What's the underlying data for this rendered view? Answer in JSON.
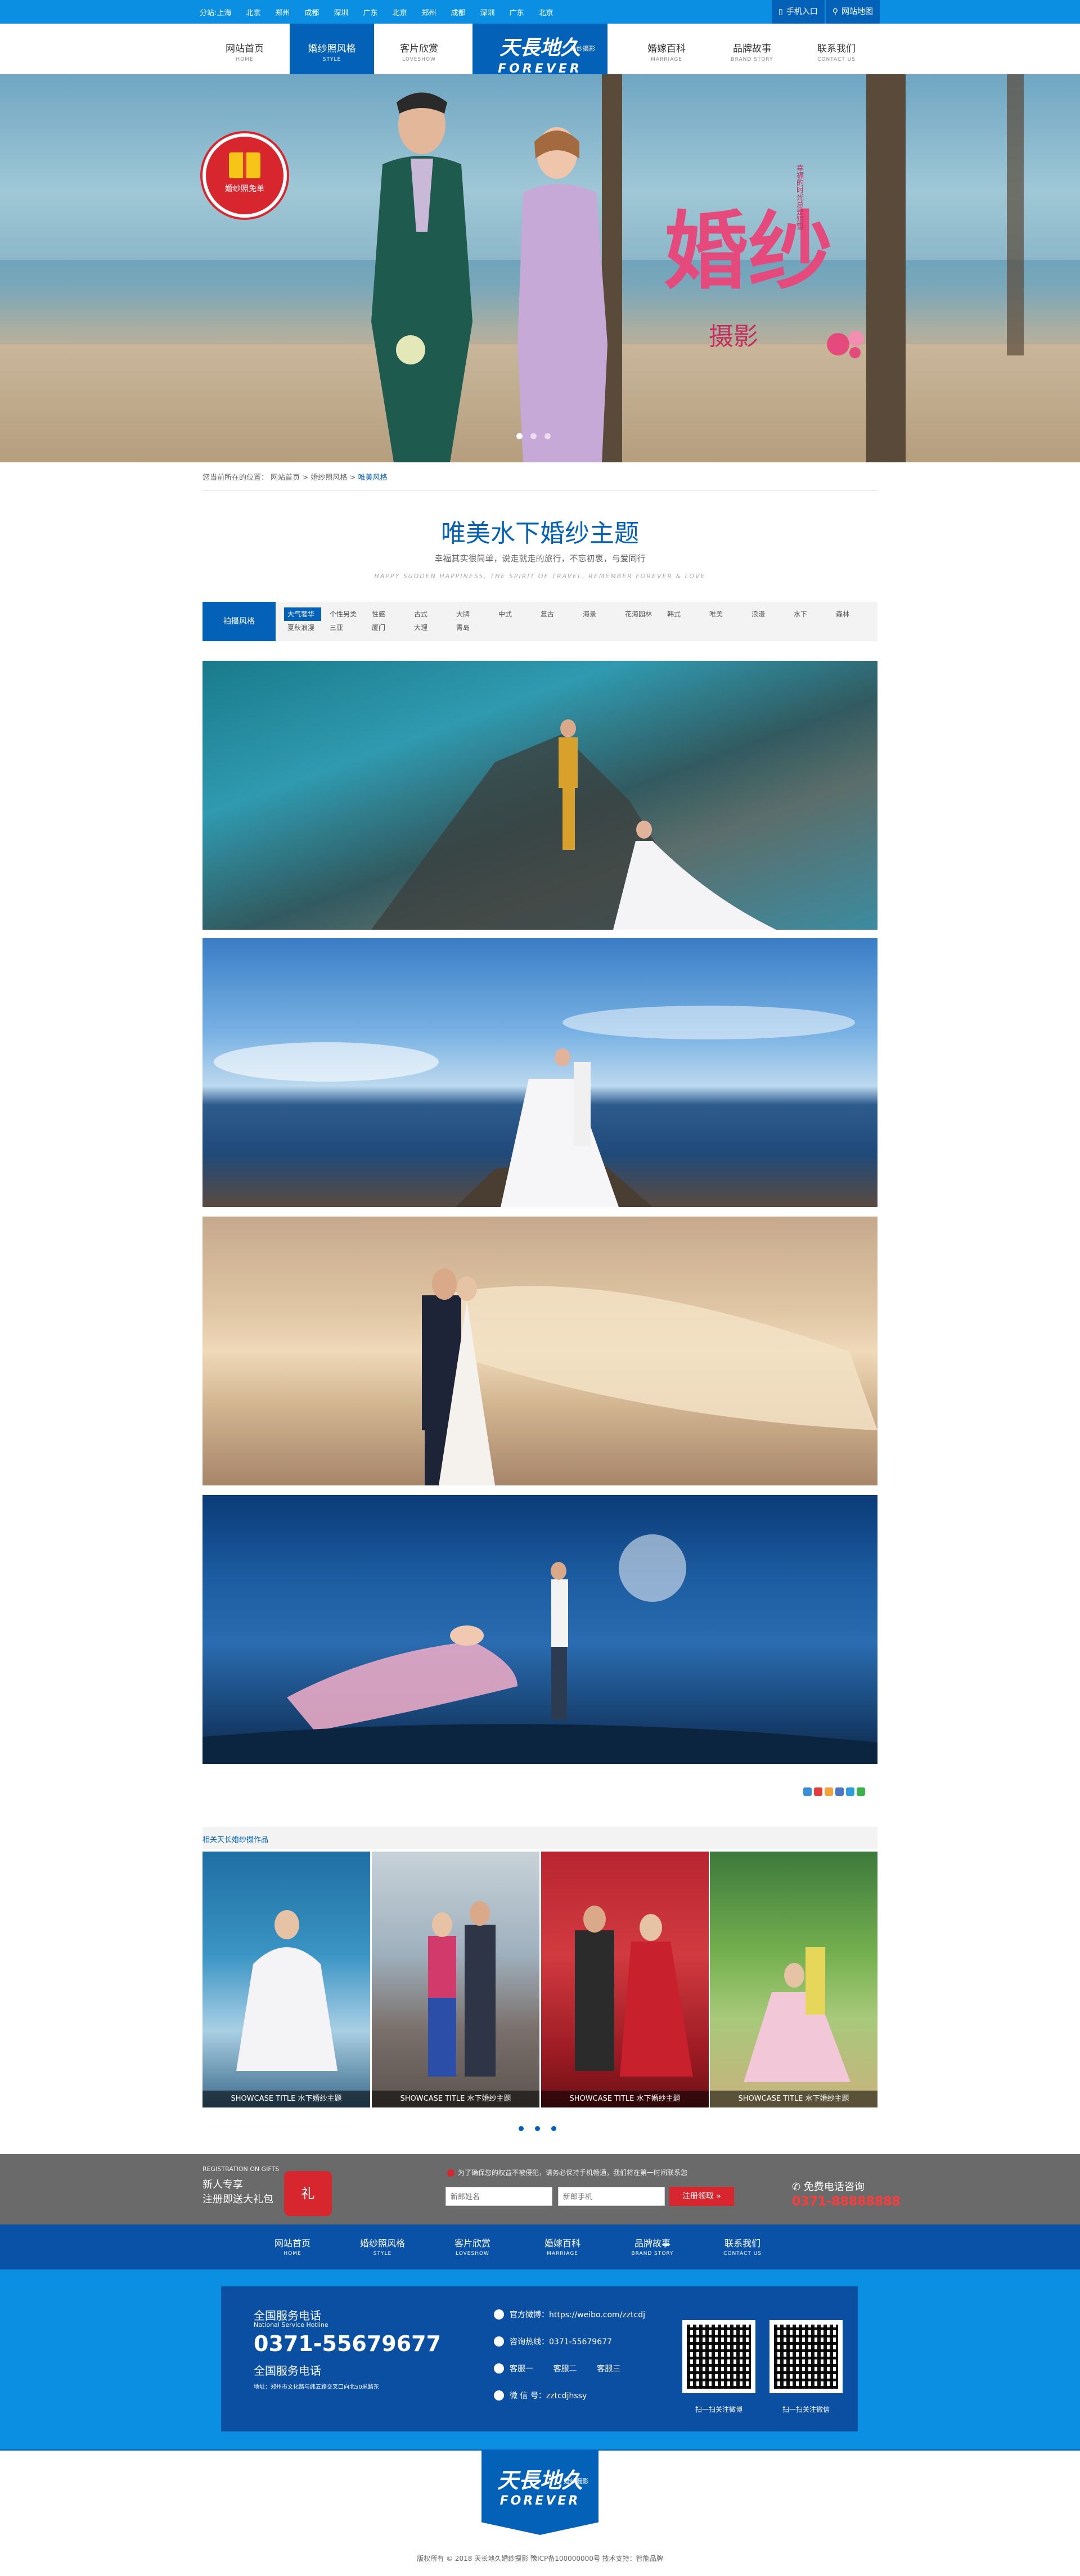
{
  "topbar": {
    "cities": [
      "分站:上海",
      "北京",
      "郑州",
      "成都",
      "深圳",
      "广东",
      "北京",
      "郑州",
      "成都",
      "深圳",
      "广东",
      "北京"
    ],
    "mobile": "手机入口",
    "map": "网站地图"
  },
  "nav": {
    "items": [
      {
        "zh": "网站首页",
        "en": "HOME"
      },
      {
        "zh": "婚纱照风格",
        "en": "STYLE"
      },
      {
        "zh": "客片欣赏",
        "en": "LOVESHOW"
      },
      {
        "zh": "婚嫁百科",
        "en": "MARRIAGE"
      },
      {
        "zh": "品牌故事",
        "en": "BRAND STORY"
      },
      {
        "zh": "联系我们",
        "en": "CONTACT US"
      }
    ],
    "logo_cn": "天長地久",
    "logo_sub": "婚纱摄影",
    "logo_en": "FOREVER"
  },
  "hero": {
    "badge": "婚纱照免单",
    "title_big": "婚纱",
    "title_small": "摄影",
    "side_text": "幸福的时光总是短暂"
  },
  "breadcrumb": {
    "prefix": "您当前所在的位置：",
    "home": "网站首页",
    "sep": ">",
    "level1": "婚纱照风格",
    "current": "唯美风格"
  },
  "page": {
    "title": "唯美水下婚纱主题",
    "subtitle": "幸福其实很简单，说走就走的旅行，不忘初衷，与爱同行",
    "english": "HAPPY SUDDEN HAPPINESS, THE SPIRIT OF TRAVEL, REMEMBER FOREVER & LOVE"
  },
  "filter": {
    "label": "拍摄风格",
    "tags": [
      "大气奢华",
      "个性另类",
      "性感",
      "古式",
      "大牌",
      "中式",
      "复古",
      "海景",
      "花海园林",
      "韩式",
      "唯美",
      "浪漫",
      "水下",
      "森林",
      "夏秋浪漫",
      "三亚",
      "厦门",
      "大理",
      "青岛"
    ]
  },
  "related": {
    "title": "相关天长婚纱摄作品",
    "captions": [
      "SHOWCASE TITLE 水下婚纱主题",
      "SHOWCASE TITLE 水下婚纱主题",
      "SHOWCASE TITLE 水下婚纱主题",
      "SHOWCASE TITLE 水下婚纱主题"
    ]
  },
  "registration": {
    "en": "REGISTRATION ON GIFTS",
    "line1": "新人专享",
    "line2": "注册即送大礼包",
    "bag": "礼",
    "notice": "为了确保您的权益不被侵犯，请务必保持手机畅通，我们将在第一时间联系您",
    "name_placeholder": "新郎姓名",
    "phone_placeholder": "新郎手机",
    "button": "注册领取 »",
    "hotline_label": "免费电话咨询",
    "hotline": "0371-88888888"
  },
  "footer_nav": [
    {
      "zh": "网站首页",
      "en": "HOME"
    },
    {
      "zh": "婚纱照风格",
      "en": "STYLE"
    },
    {
      "zh": "客片欣赏",
      "en": "LOVESHOW"
    },
    {
      "zh": "婚嫁百科",
      "en": "MARRIAGE"
    },
    {
      "zh": "品牌故事",
      "en": "BRAND STORY"
    },
    {
      "zh": "联系我们",
      "en": "CONTACT US"
    }
  ],
  "footer": {
    "hot_label": "全国服务电话",
    "hot_en": "National Service Hotline",
    "hot_number": "0371-55679677",
    "hot_label2": "全国服务电话",
    "address": "地址：郑州市文化路与纬五路交叉口向北50米路东",
    "weibo": "官方微博：https://weibo.com/zztcdj",
    "tel": "咨询热线：0371-55679677",
    "qq": "客服一        客服二        客服三",
    "wechat": "微 信 号：zztcdjhssy",
    "qr1": "扫一扫关注微博",
    "qr2": "扫一扫关注微信"
  },
  "bottom": {
    "logo_cn": "天長地久",
    "logo_sub": "婚纱摄影",
    "logo_en": "FOREVER",
    "copyright": "版权所有 © 2018 天长地久婚纱摄影 豫ICP备100000000号 技术支持：智能品牌"
  },
  "colors": {
    "primary": "#0461b8",
    "topbar": "#0a8fe3",
    "accent": "#d8262e"
  }
}
